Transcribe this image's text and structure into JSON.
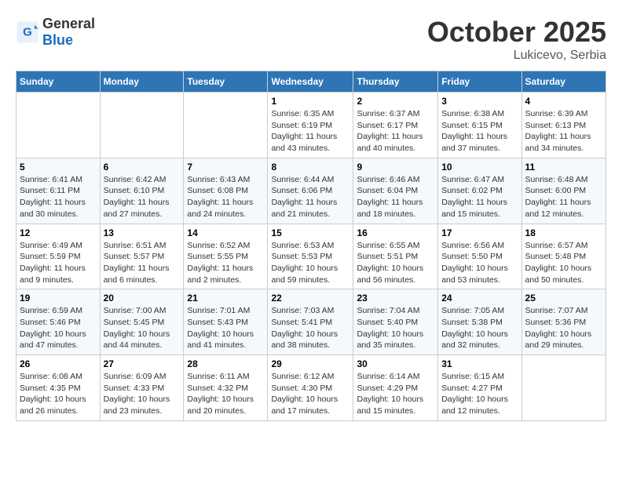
{
  "header": {
    "logo_general": "General",
    "logo_blue": "Blue",
    "month_title": "October 2025",
    "location": "Lukicevo, Serbia"
  },
  "weekdays": [
    "Sunday",
    "Monday",
    "Tuesday",
    "Wednesday",
    "Thursday",
    "Friday",
    "Saturday"
  ],
  "weeks": [
    [
      {
        "day": "",
        "info": ""
      },
      {
        "day": "",
        "info": ""
      },
      {
        "day": "",
        "info": ""
      },
      {
        "day": "1",
        "info": "Sunrise: 6:35 AM\nSunset: 6:19 PM\nDaylight: 11 hours\nand 43 minutes."
      },
      {
        "day": "2",
        "info": "Sunrise: 6:37 AM\nSunset: 6:17 PM\nDaylight: 11 hours\nand 40 minutes."
      },
      {
        "day": "3",
        "info": "Sunrise: 6:38 AM\nSunset: 6:15 PM\nDaylight: 11 hours\nand 37 minutes."
      },
      {
        "day": "4",
        "info": "Sunrise: 6:39 AM\nSunset: 6:13 PM\nDaylight: 11 hours\nand 34 minutes."
      }
    ],
    [
      {
        "day": "5",
        "info": "Sunrise: 6:41 AM\nSunset: 6:11 PM\nDaylight: 11 hours\nand 30 minutes."
      },
      {
        "day": "6",
        "info": "Sunrise: 6:42 AM\nSunset: 6:10 PM\nDaylight: 11 hours\nand 27 minutes."
      },
      {
        "day": "7",
        "info": "Sunrise: 6:43 AM\nSunset: 6:08 PM\nDaylight: 11 hours\nand 24 minutes."
      },
      {
        "day": "8",
        "info": "Sunrise: 6:44 AM\nSunset: 6:06 PM\nDaylight: 11 hours\nand 21 minutes."
      },
      {
        "day": "9",
        "info": "Sunrise: 6:46 AM\nSunset: 6:04 PM\nDaylight: 11 hours\nand 18 minutes."
      },
      {
        "day": "10",
        "info": "Sunrise: 6:47 AM\nSunset: 6:02 PM\nDaylight: 11 hours\nand 15 minutes."
      },
      {
        "day": "11",
        "info": "Sunrise: 6:48 AM\nSunset: 6:00 PM\nDaylight: 11 hours\nand 12 minutes."
      }
    ],
    [
      {
        "day": "12",
        "info": "Sunrise: 6:49 AM\nSunset: 5:59 PM\nDaylight: 11 hours\nand 9 minutes."
      },
      {
        "day": "13",
        "info": "Sunrise: 6:51 AM\nSunset: 5:57 PM\nDaylight: 11 hours\nand 6 minutes."
      },
      {
        "day": "14",
        "info": "Sunrise: 6:52 AM\nSunset: 5:55 PM\nDaylight: 11 hours\nand 2 minutes."
      },
      {
        "day": "15",
        "info": "Sunrise: 6:53 AM\nSunset: 5:53 PM\nDaylight: 10 hours\nand 59 minutes."
      },
      {
        "day": "16",
        "info": "Sunrise: 6:55 AM\nSunset: 5:51 PM\nDaylight: 10 hours\nand 56 minutes."
      },
      {
        "day": "17",
        "info": "Sunrise: 6:56 AM\nSunset: 5:50 PM\nDaylight: 10 hours\nand 53 minutes."
      },
      {
        "day": "18",
        "info": "Sunrise: 6:57 AM\nSunset: 5:48 PM\nDaylight: 10 hours\nand 50 minutes."
      }
    ],
    [
      {
        "day": "19",
        "info": "Sunrise: 6:59 AM\nSunset: 5:46 PM\nDaylight: 10 hours\nand 47 minutes."
      },
      {
        "day": "20",
        "info": "Sunrise: 7:00 AM\nSunset: 5:45 PM\nDaylight: 10 hours\nand 44 minutes."
      },
      {
        "day": "21",
        "info": "Sunrise: 7:01 AM\nSunset: 5:43 PM\nDaylight: 10 hours\nand 41 minutes."
      },
      {
        "day": "22",
        "info": "Sunrise: 7:03 AM\nSunset: 5:41 PM\nDaylight: 10 hours\nand 38 minutes."
      },
      {
        "day": "23",
        "info": "Sunrise: 7:04 AM\nSunset: 5:40 PM\nDaylight: 10 hours\nand 35 minutes."
      },
      {
        "day": "24",
        "info": "Sunrise: 7:05 AM\nSunset: 5:38 PM\nDaylight: 10 hours\nand 32 minutes."
      },
      {
        "day": "25",
        "info": "Sunrise: 7:07 AM\nSunset: 5:36 PM\nDaylight: 10 hours\nand 29 minutes."
      }
    ],
    [
      {
        "day": "26",
        "info": "Sunrise: 6:08 AM\nSunset: 4:35 PM\nDaylight: 10 hours\nand 26 minutes."
      },
      {
        "day": "27",
        "info": "Sunrise: 6:09 AM\nSunset: 4:33 PM\nDaylight: 10 hours\nand 23 minutes."
      },
      {
        "day": "28",
        "info": "Sunrise: 6:11 AM\nSunset: 4:32 PM\nDaylight: 10 hours\nand 20 minutes."
      },
      {
        "day": "29",
        "info": "Sunrise: 6:12 AM\nSunset: 4:30 PM\nDaylight: 10 hours\nand 17 minutes."
      },
      {
        "day": "30",
        "info": "Sunrise: 6:14 AM\nSunset: 4:29 PM\nDaylight: 10 hours\nand 15 minutes."
      },
      {
        "day": "31",
        "info": "Sunrise: 6:15 AM\nSunset: 4:27 PM\nDaylight: 10 hours\nand 12 minutes."
      },
      {
        "day": "",
        "info": ""
      }
    ]
  ]
}
